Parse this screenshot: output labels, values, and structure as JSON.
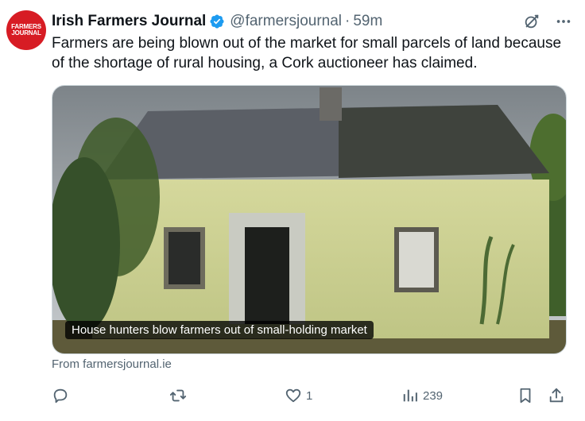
{
  "author": {
    "name": "Irish Farmers Journal",
    "handle": "@farmersjournal",
    "separator": "·",
    "time": "59m",
    "avatar_line1": "FARMERS",
    "avatar_line2": "JOURNAL",
    "avatar_color": "#d71c24",
    "verified_color": "#1d9bf0"
  },
  "tweet": {
    "text": "Farmers are being blown out of the market for small parcels of land because of the shortage of rural housing, a Cork auctioneer has claimed."
  },
  "media": {
    "caption": "House hunters blow farmers out of small-holding market",
    "source": "From farmersjournal.ie"
  },
  "actions": {
    "reply_icon": "reply-icon",
    "repost_icon": "repost-icon",
    "like_icon": "heart-icon",
    "like_count": "1",
    "views_icon": "views-icon",
    "views_count": "239",
    "bookmark_icon": "bookmark-icon",
    "share_icon": "share-icon"
  },
  "header_icons": [
    "grok-icon",
    "more-icon"
  ]
}
